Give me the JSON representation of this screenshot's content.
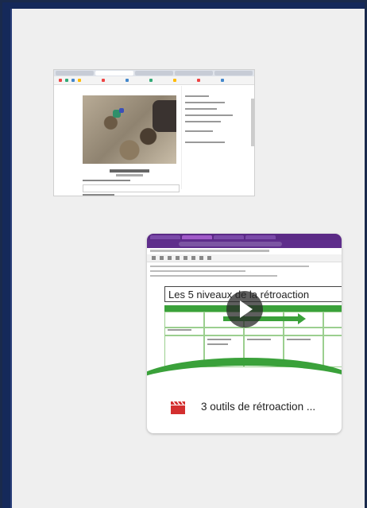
{
  "video_card": {
    "title": "3 outils de rétroaction ...",
    "thumbnail_heading": "Les 5 niveaux de la rétroaction",
    "icon": "video-clapperboard-icon",
    "accent": "#d32f2f"
  },
  "colors": {
    "panel": "#efefef",
    "frame": "#15295a",
    "table_green": "#3aa13a",
    "browser_purple": "#5b2a86"
  }
}
